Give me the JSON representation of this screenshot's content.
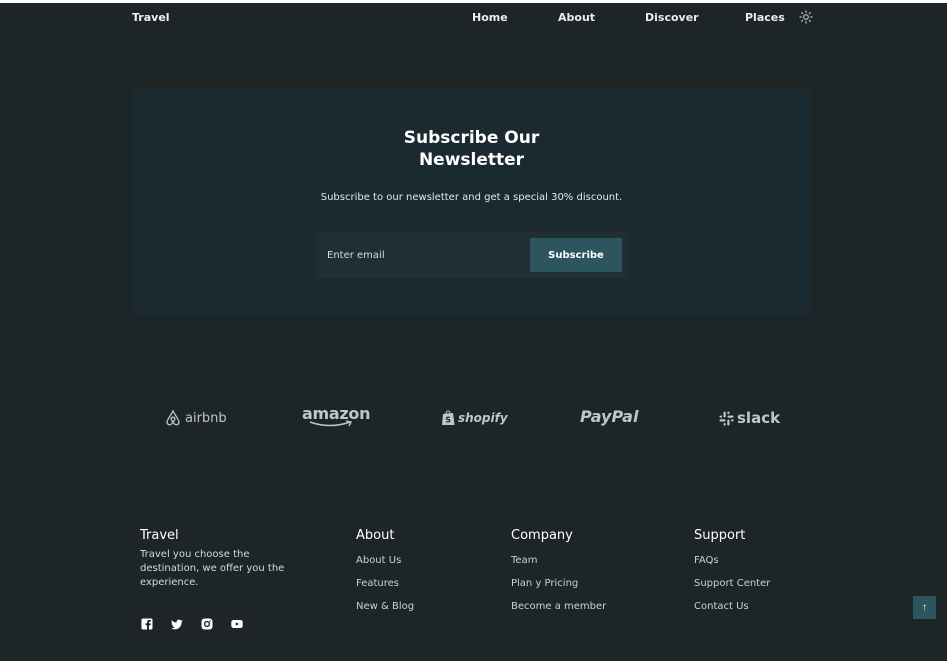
{
  "header": {
    "brand": "Travel",
    "nav": [
      {
        "label": "Home"
      },
      {
        "label": "About"
      },
      {
        "label": "Discover"
      },
      {
        "label": "Places"
      }
    ],
    "theme_icon": "sun-icon"
  },
  "newsletter": {
    "title_line1": "Subscribe Our",
    "title_line2": "Newsletter",
    "description": "Subscribe to our newsletter and get a special 30% discount.",
    "email_placeholder": "Enter email",
    "email_value": "",
    "button_label": "Subscribe"
  },
  "partners": [
    {
      "name": "airbnb",
      "icon": "airbnb-logo"
    },
    {
      "name": "amazon",
      "icon": "amazon-logo"
    },
    {
      "name": "shopify",
      "icon": "shopify-logo"
    },
    {
      "name": "PayPal",
      "icon": "paypal-logo"
    },
    {
      "name": "slack",
      "icon": "slack-logo"
    }
  ],
  "footer": {
    "brand": {
      "title": "Travel",
      "description": "Travel you choose the destination, we offer you the experience.",
      "social": [
        "facebook-icon",
        "twitter-icon",
        "instagram-icon",
        "youtube-icon"
      ]
    },
    "about": {
      "title": "About",
      "links": [
        "About Us",
        "Features",
        "New & Blog"
      ]
    },
    "company": {
      "title": "Company",
      "links": [
        "Team",
        "Plan y Pricing",
        "Become a member"
      ]
    },
    "support": {
      "title": "Support",
      "links": [
        "FAQs",
        "Support Center",
        "Contact Us"
      ]
    }
  },
  "scroll_top": {
    "icon": "arrow-up-icon",
    "glyph": "↑"
  },
  "colors": {
    "background": "#1d2527",
    "newsletter_bg": "#1a2a30",
    "accent": "#2c5560",
    "logo_gray": "#bfc6c8"
  }
}
